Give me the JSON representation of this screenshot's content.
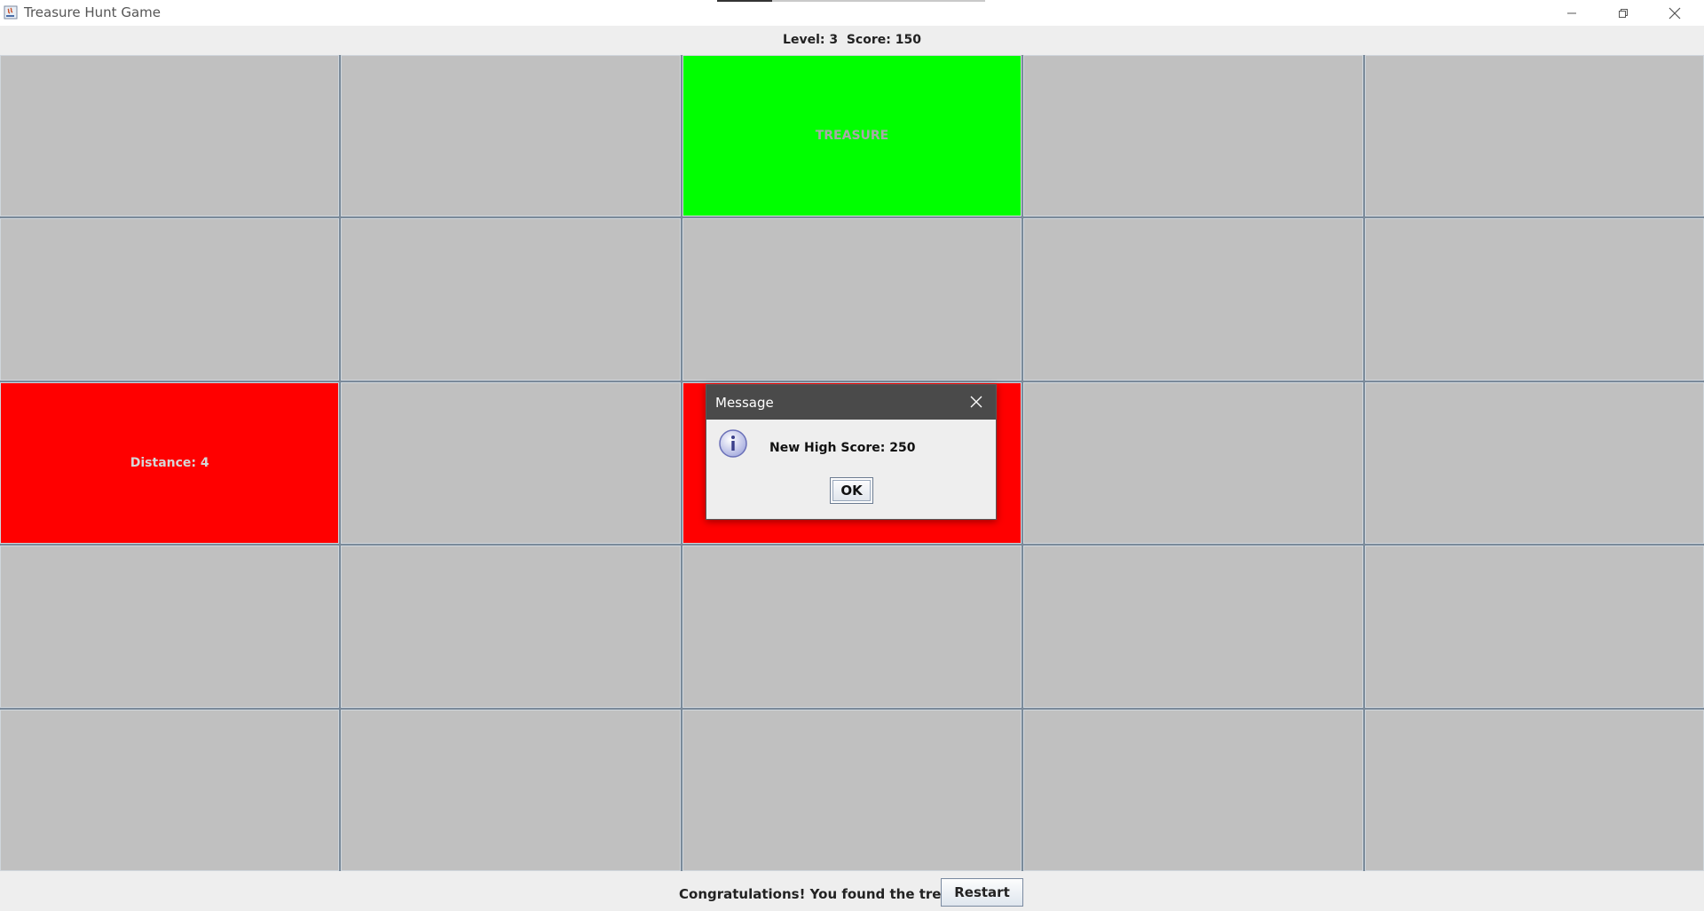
{
  "window": {
    "title": "Treasure Hunt Game",
    "controls": [
      "minimize-icon",
      "restore-icon",
      "close-icon"
    ]
  },
  "status": {
    "text": "Level: 3  Score: 150"
  },
  "grid": {
    "rows": 5,
    "cols": 5,
    "cells": [
      {
        "label": "",
        "state": "hidden"
      },
      {
        "label": "",
        "state": "hidden"
      },
      {
        "label": "TREASURE",
        "state": "treasure"
      },
      {
        "label": "",
        "state": "hidden"
      },
      {
        "label": "",
        "state": "hidden"
      },
      {
        "label": "",
        "state": "hidden"
      },
      {
        "label": "",
        "state": "hidden"
      },
      {
        "label": "",
        "state": "hidden"
      },
      {
        "label": "",
        "state": "hidden"
      },
      {
        "label": "",
        "state": "hidden"
      },
      {
        "label": "Distance: 4",
        "state": "revealed"
      },
      {
        "label": "",
        "state": "hidden"
      },
      {
        "label": "",
        "state": "revealed"
      },
      {
        "label": "",
        "state": "hidden"
      },
      {
        "label": "",
        "state": "hidden"
      },
      {
        "label": "",
        "state": "hidden"
      },
      {
        "label": "",
        "state": "hidden"
      },
      {
        "label": "",
        "state": "hidden"
      },
      {
        "label": "",
        "state": "hidden"
      },
      {
        "label": "",
        "state": "hidden"
      },
      {
        "label": "",
        "state": "hidden"
      },
      {
        "label": "",
        "state": "hidden"
      },
      {
        "label": "",
        "state": "hidden"
      },
      {
        "label": "",
        "state": "hidden"
      },
      {
        "label": "",
        "state": "hidden"
      }
    ],
    "colors": {
      "hidden": "#c0c0c0",
      "treasure": "#00ff00",
      "revealed": "#ff0000"
    }
  },
  "footer": {
    "message": "Congratulations! You found the treasure!",
    "restart_label": "Restart"
  },
  "dialog": {
    "title": "Message",
    "icon": "info-icon",
    "message": "New High Score: 250",
    "ok_label": "OK"
  }
}
